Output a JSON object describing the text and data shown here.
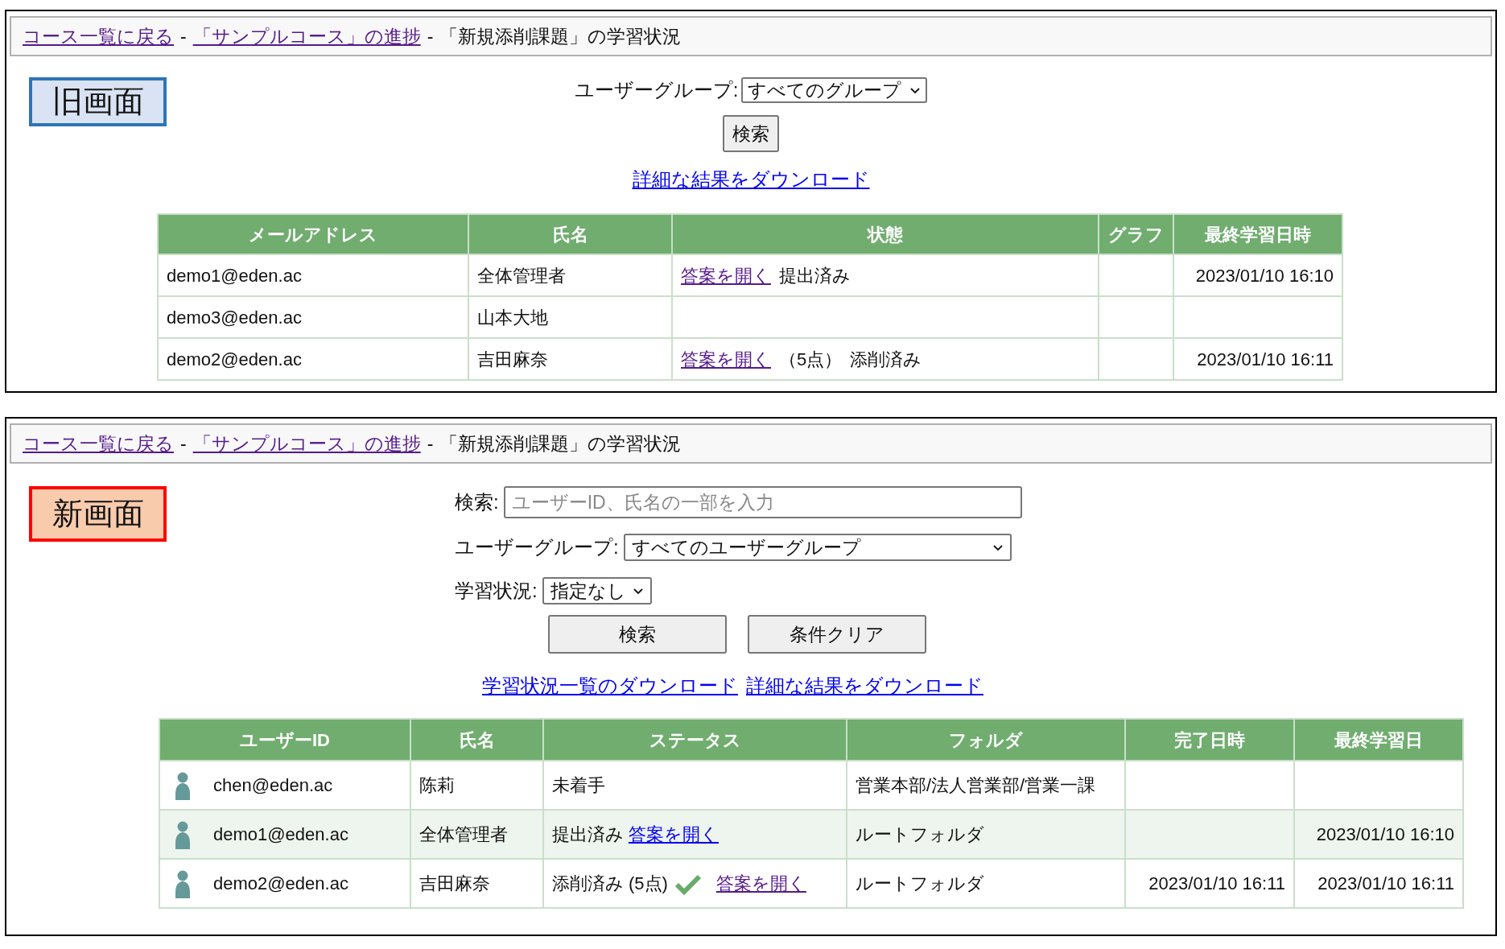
{
  "old_screen": {
    "label": "旧画面",
    "breadcrumb": [
      {
        "kind": "link",
        "text": "コース一覧に戻る",
        "visited": true
      },
      {
        "kind": "text",
        "text": "-"
      },
      {
        "kind": "link",
        "text": "「サンプルコース」の進捗",
        "visited": true
      },
      {
        "kind": "text",
        "text": "-"
      },
      {
        "kind": "text",
        "text": "「新規添削課題」の学習状況"
      }
    ],
    "user_group": {
      "label": "ユーザーグループ:",
      "value": "すべてのグループ"
    },
    "search_button": "検索",
    "download_links": [
      "詳細な結果をダウンロード"
    ],
    "table": {
      "columns": [
        "メールアドレス",
        "氏名",
        "状態",
        "グラフ",
        "最終学習日時"
      ],
      "rows": [
        {
          "email": "demo1@eden.ac",
          "name": "全体管理者",
          "status": [
            {
              "kind": "link",
              "text": "答案を開く",
              "visited": true
            },
            {
              "kind": "text",
              "text": "提出済み"
            }
          ],
          "last_study": "2023/01/10 16:10"
        },
        {
          "email": "demo3@eden.ac",
          "name": "山本大地",
          "status": [],
          "last_study": ""
        },
        {
          "email": "demo2@eden.ac",
          "name": "吉田麻奈",
          "status": [
            {
              "kind": "link",
              "text": "答案を開く",
              "visited": true
            },
            {
              "kind": "text",
              "text": "（5点）"
            },
            {
              "kind": "text",
              "text": "添削済み"
            }
          ],
          "last_study": "2023/01/10 16:11"
        }
      ]
    }
  },
  "new_screen": {
    "label": "新画面",
    "breadcrumb": [
      {
        "kind": "link",
        "text": "コース一覧に戻る",
        "visited": true
      },
      {
        "kind": "text",
        "text": "-"
      },
      {
        "kind": "link",
        "text": "「サンプルコース」の進捗",
        "visited": true
      },
      {
        "kind": "text",
        "text": "-"
      },
      {
        "kind": "text",
        "text": "「新規添削課題」の学習状況"
      }
    ],
    "search": {
      "label": "検索:",
      "placeholder": "ユーザーID、氏名の一部を入力"
    },
    "user_group": {
      "label": "ユーザーグループ:",
      "value": "すべてのユーザーグループ"
    },
    "learning_status": {
      "label": "学習状況:",
      "value": "指定なし"
    },
    "buttons": [
      "検索",
      "条件クリア"
    ],
    "download_links": [
      "学習状況一覧のダウンロード",
      "詳細な結果をダウンロード"
    ],
    "table": {
      "columns": [
        "ユーザーID",
        "氏名",
        "ステータス",
        "フォルダ",
        "完了日時",
        "最終学習日"
      ],
      "rows": [
        {
          "highlighted": false,
          "user_id": "chen@eden.ac",
          "name": "陈莉",
          "status": [
            {
              "kind": "text",
              "text": "未着手"
            }
          ],
          "folder": "営業本部/法人営業部/営業一課",
          "completed": "",
          "last_study": ""
        },
        {
          "highlighted": true,
          "user_id": "demo1@eden.ac",
          "name": "全体管理者",
          "status": [
            {
              "kind": "text",
              "text": "提出済み"
            },
            {
              "kind": "link",
              "text": "答案を開く",
              "visited": false
            }
          ],
          "folder": "ルートフォルダ",
          "completed": "",
          "last_study": "2023/01/10 16:10"
        },
        {
          "highlighted": false,
          "user_id": "demo2@eden.ac",
          "name": "吉田麻奈",
          "status": [
            {
              "kind": "text",
              "text": "添削済み"
            },
            {
              "kind": "text",
              "text": "(5点)"
            },
            {
              "kind": "check"
            },
            {
              "kind": "link",
              "text": "答案を開く",
              "visited": true
            }
          ],
          "folder": "ルートフォルダ",
          "completed": "2023/01/10 16:11",
          "last_study": "2023/01/10 16:11"
        }
      ]
    }
  }
}
